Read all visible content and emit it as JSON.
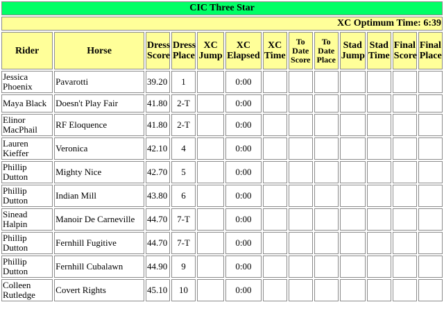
{
  "title": "CIC Three Star",
  "optimum": "XC Optimum Time: 6:39",
  "headers": [
    "Rider",
    "Horse",
    "Dress Score",
    "Dress Place",
    "XC Jump",
    "XC Elapsed",
    "XC Time",
    "To Date Score",
    "To Date Place",
    "Stad Jump",
    "Stad Time",
    "Final Score",
    "Final Place"
  ],
  "rows": [
    {
      "rider": "Jessica Phoenix",
      "horse": "Pavarotti",
      "dress_score": "39.20",
      "dress_place": "1",
      "xc_elapsed": "0:00"
    },
    {
      "rider": "Maya Black",
      "horse": "Doesn't Play Fair",
      "dress_score": "41.80",
      "dress_place": "2-T",
      "xc_elapsed": "0:00"
    },
    {
      "rider": "Elinor MacPhail",
      "horse": "RF Eloquence",
      "dress_score": "41.80",
      "dress_place": "2-T",
      "xc_elapsed": "0:00"
    },
    {
      "rider": "Lauren Kieffer",
      "horse": "Veronica",
      "dress_score": "42.10",
      "dress_place": "4",
      "xc_elapsed": "0:00"
    },
    {
      "rider": "Phillip Dutton",
      "horse": "Mighty Nice",
      "dress_score": "42.70",
      "dress_place": "5",
      "xc_elapsed": "0:00"
    },
    {
      "rider": "Phillip Dutton",
      "horse": "Indian Mill",
      "dress_score": "43.80",
      "dress_place": "6",
      "xc_elapsed": "0:00"
    },
    {
      "rider": "Sinead Halpin",
      "horse": "Manoir De Carneville",
      "dress_score": "44.70",
      "dress_place": "7-T",
      "xc_elapsed": "0:00"
    },
    {
      "rider": "Phillip Dutton",
      "horse": "Fernhill Fugitive",
      "dress_score": "44.70",
      "dress_place": "7-T",
      "xc_elapsed": "0:00"
    },
    {
      "rider": "Phillip Dutton",
      "horse": "Fernhill Cubalawn",
      "dress_score": "44.90",
      "dress_place": "9",
      "xc_elapsed": "0:00"
    },
    {
      "rider": "Colleen Rutledge",
      "horse": "Covert Rights",
      "dress_score": "45.10",
      "dress_place": "10",
      "xc_elapsed": "0:00"
    }
  ]
}
